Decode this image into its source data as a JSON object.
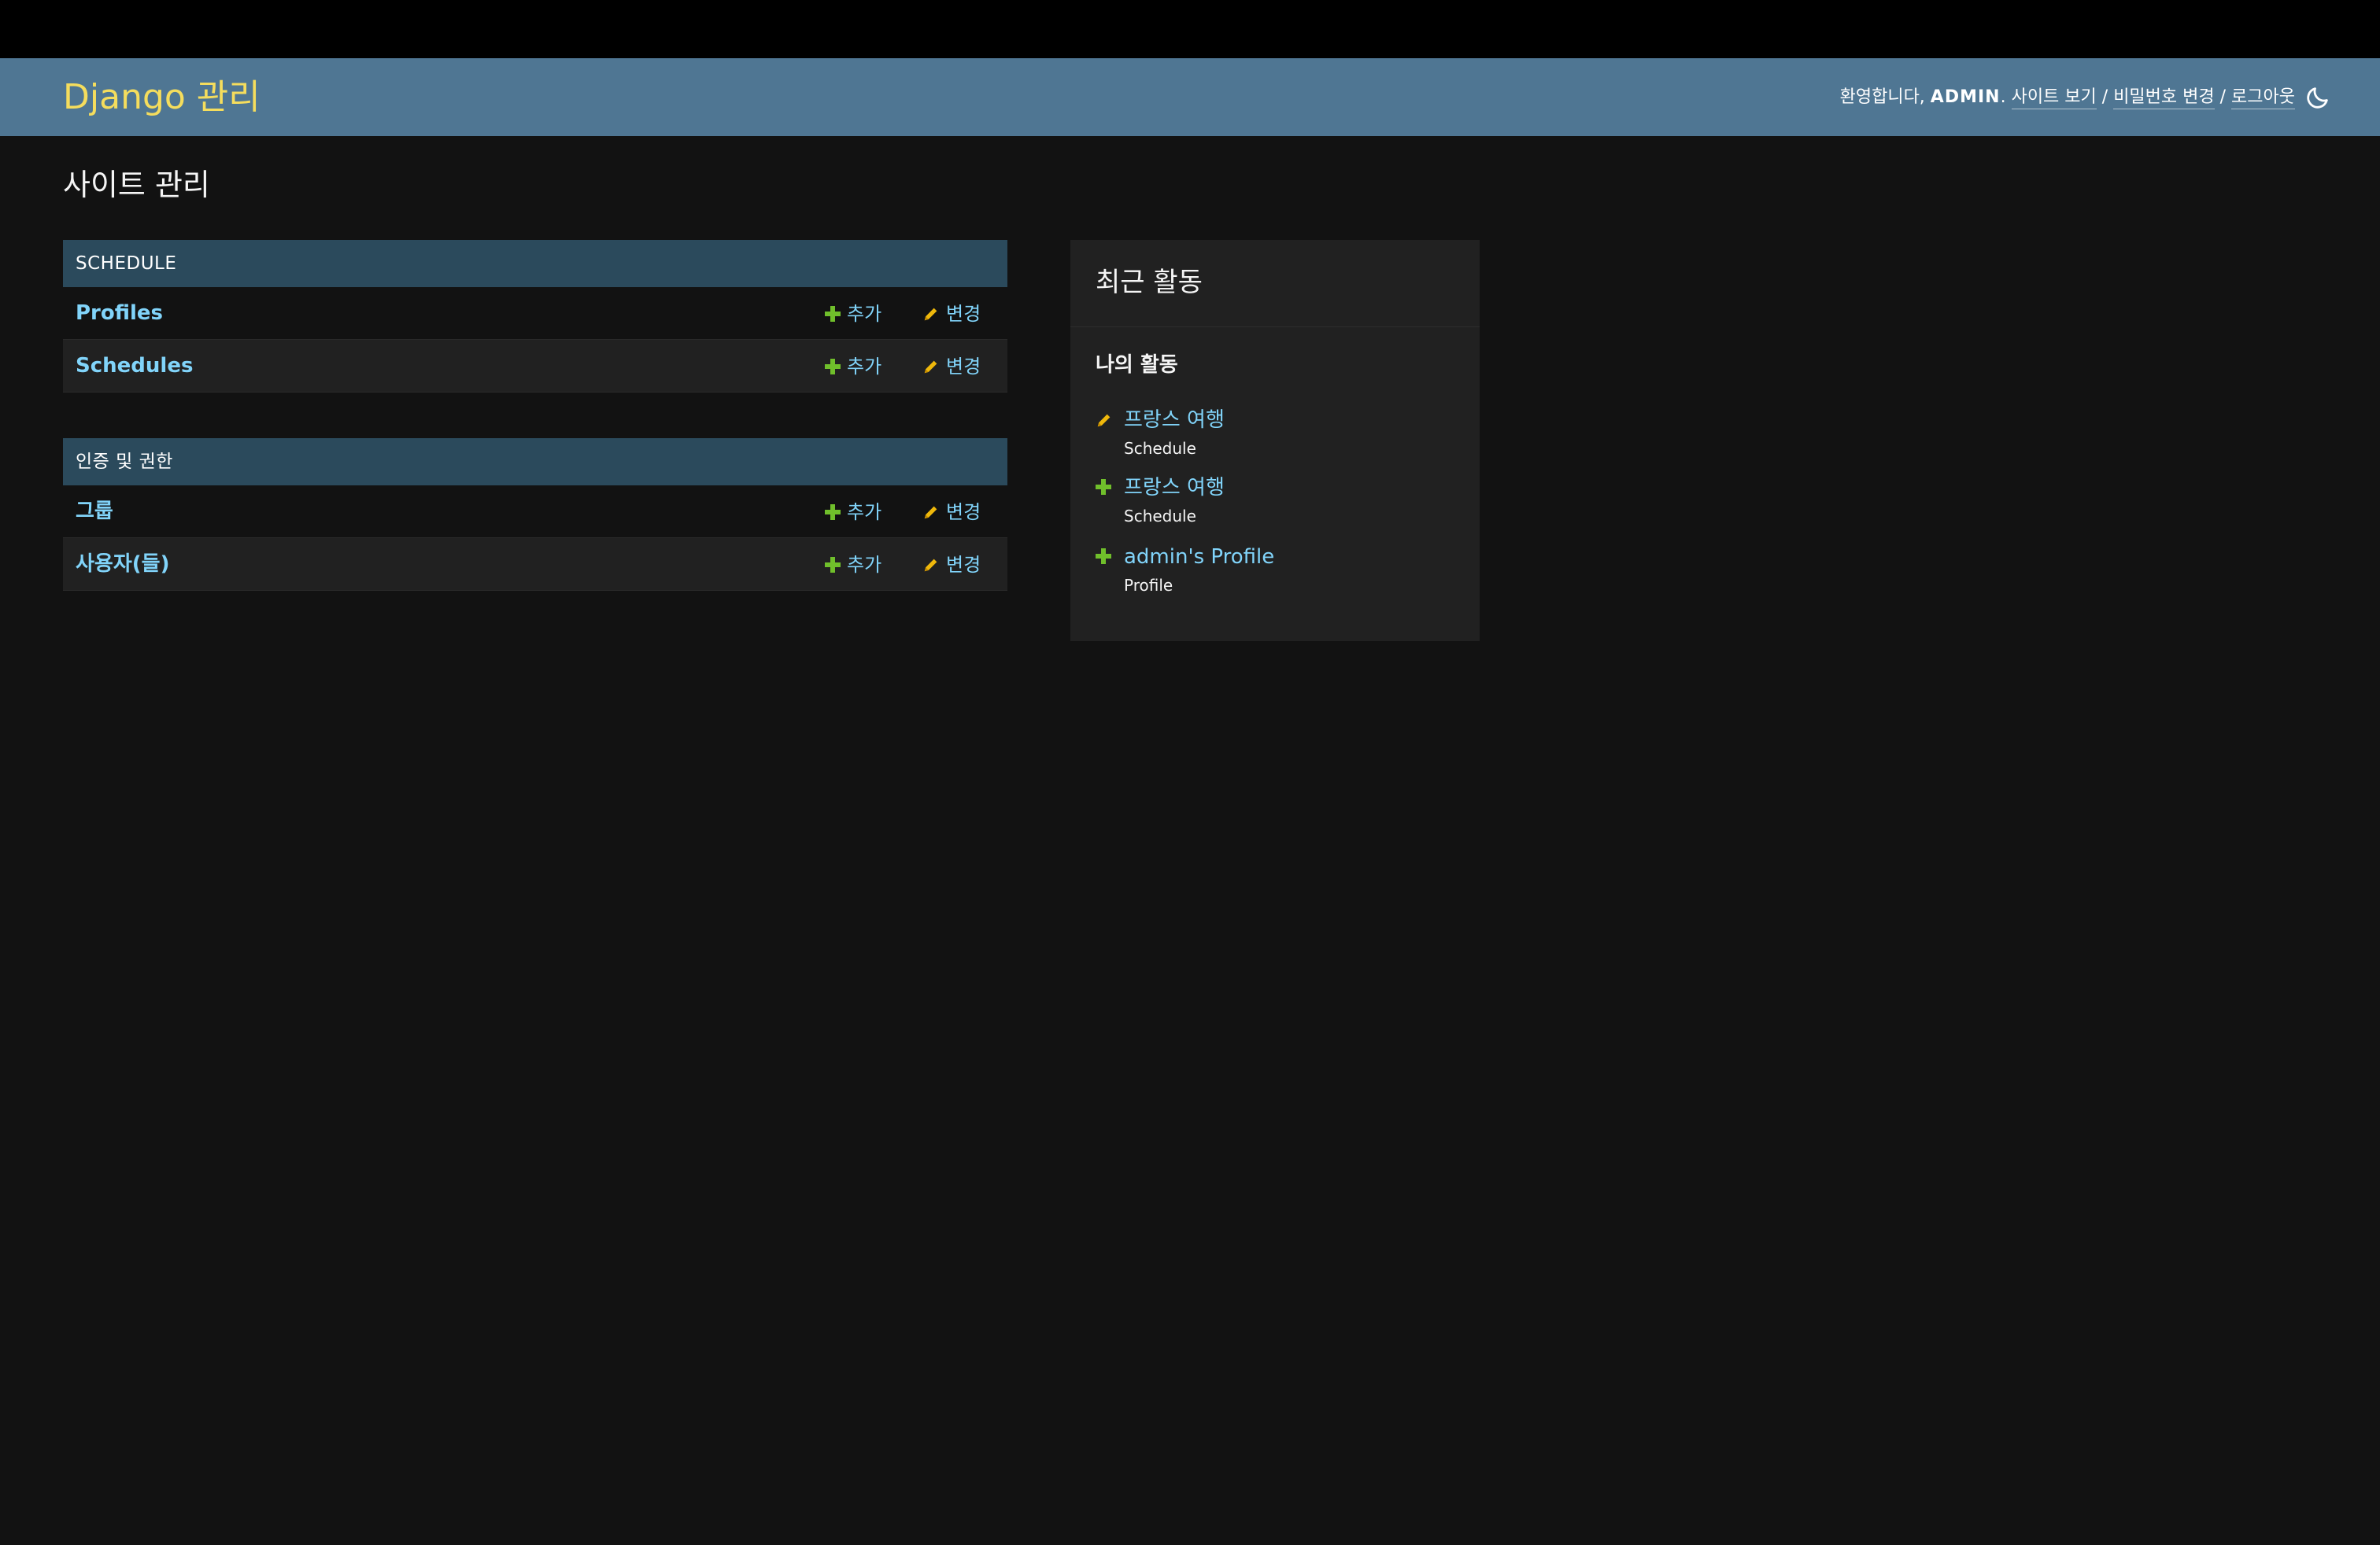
{
  "header": {
    "brand": "Django 관리",
    "welcome": "환영합니다, ",
    "username": "ADMIN",
    "username_suffix": ". ",
    "view_site": "사이트 보기",
    "separator": " / ",
    "change_password": "비밀번호 변경",
    "logout": "로그아웃",
    "theme_icon": "moon-icon"
  },
  "page": {
    "title": "사이트 관리"
  },
  "modules": [
    {
      "caption": "SCHEDULE",
      "models": [
        {
          "name": "Profiles",
          "add": "추가",
          "change": "변경"
        },
        {
          "name": "Schedules",
          "add": "추가",
          "change": "변경"
        }
      ]
    },
    {
      "caption": "인증 및 권한",
      "models": [
        {
          "name": "그룹",
          "add": "추가",
          "change": "변경"
        },
        {
          "name": "사용자(들)",
          "add": "추가",
          "change": "변경"
        }
      ]
    }
  ],
  "recent_actions": {
    "title": "최근 활동",
    "subtitle": "나의 활동",
    "items": [
      {
        "icon": "pencil-icon",
        "label": "프랑스 여행",
        "type": "Schedule"
      },
      {
        "icon": "plus-icon",
        "label": "프랑스 여행",
        "type": "Schedule"
      },
      {
        "icon": "plus-icon",
        "label": "admin's Profile",
        "type": "Profile"
      }
    ]
  },
  "colors": {
    "header_bg": "#4f7693",
    "brand": "#f5dd5d",
    "module_caption_bg": "#2b4a5c",
    "link": "#81d4fa",
    "add_icon": "#70bf2b",
    "change_icon": "#efb80b",
    "body_bg": "#121212"
  }
}
